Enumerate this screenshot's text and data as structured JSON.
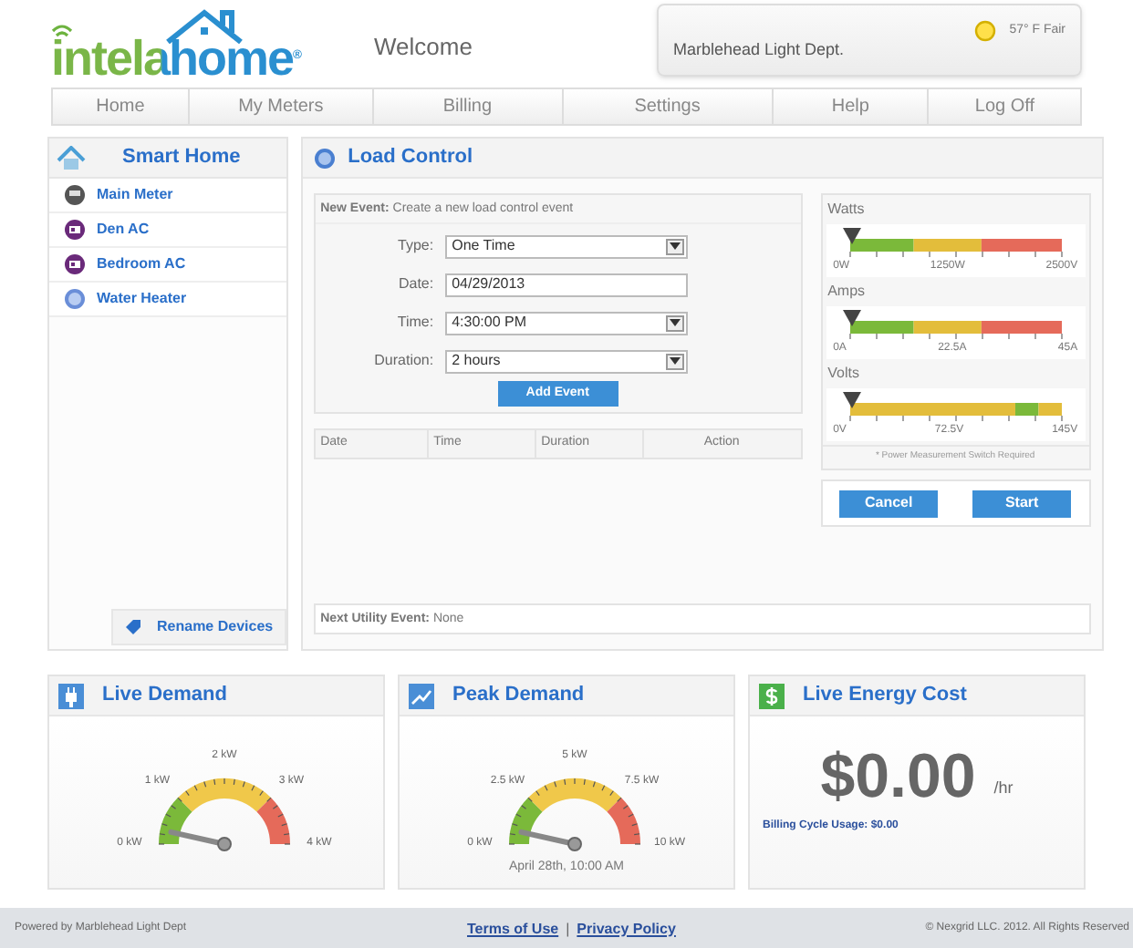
{
  "header": {
    "logo": "intelahome$^{®}$",
    "welcome": "Welcome",
    "utility": "Marblehead Light Dept.",
    "weather": "57° F Fair"
  },
  "nav": [
    "Home",
    "My Meters",
    "Billing",
    "Settings",
    "Help",
    "Log Off"
  ],
  "sidebar": {
    "title": "Smart Home",
    "items": [
      {
        "label": "Main Meter",
        "kind": "meter"
      },
      {
        "label": "Den AC",
        "kind": "ac"
      },
      {
        "label": "Bedroom AC",
        "kind": "ac"
      },
      {
        "label": "Water Heater",
        "kind": "heater"
      }
    ],
    "rename": "Rename Devices"
  },
  "load_control": {
    "title": "Load Control",
    "intro": "**New Event:** Create a new load control event",
    "fields": [
      {
        "label": "Type:",
        "value": "One Time",
        "kind": "select"
      },
      {
        "label": "Date:",
        "value": "04/29/2013",
        "kind": "text"
      },
      {
        "label": "Time:",
        "value": "4:30:00 PM",
        "kind": "select"
      },
      {
        "label": "Duration:",
        "value": "2 hours",
        "kind": "select"
      }
    ],
    "add_button": "Add Event",
    "columns": [
      "Date",
      "Time",
      "Duration",
      "Action"
    ],
    "next_event": "**Next Utility Event:** None",
    "meters": [
      {
        "title": "Watts",
        "kind": "rising",
        "ticks": [
          "0W",
          "1250W",
          "2500V"
        ]
      },
      {
        "title": "Amps",
        "kind": "rising",
        "ticks": [
          "0A",
          "22.5A",
          "45A"
        ]
      },
      {
        "title": "Volts",
        "kind": "band",
        "ticks": [
          "0V",
          "72.5V",
          "145V"
        ]
      }
    ],
    "note": "* Power Measurement Switch Required",
    "buttons": [
      "Cancel",
      "Start"
    ]
  },
  "cards": [
    {
      "title": "Live Demand",
      "kind": "gauge",
      "ticks": [
        "0 kW",
        "1 kW",
        "2 kW",
        "3 kW",
        "4 kW"
      ]
    },
    {
      "title": "Peak Demand",
      "kind": "gauge",
      "ticks": [
        "0 kW",
        "2.5 kW",
        "5 kW",
        "7.5 kW",
        "10 kW"
      ],
      "caption": "April 28th, 10:00 AM"
    },
    {
      "title": "Live Energy Cost",
      "kind": "cost",
      "amount": "$0.00",
      "unit": "/hr",
      "usage": "Billing Cycle Usage: $0.00"
    }
  ],
  "footer": {
    "powered": "Powered by Marblehead Light Dept",
    "links": [
      "Terms of Use",
      "Privacy Policy"
    ],
    "separator": "|",
    "copyright": "© Nexgrid LLC. 2012. All Rights Reserved"
  }
}
